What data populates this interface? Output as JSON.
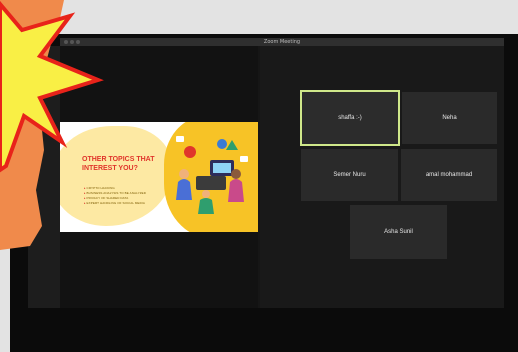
{
  "window": {
    "title": "Zoom Meeting"
  },
  "slide": {
    "title": "OTHER TOPICS THAT INTEREST YOU?",
    "bullets": [
      "CRYPTO HACKING",
      "BUSINESS ANALYSIS TO BE ANALYZED",
      "PRIVACY OF SHARED DATA",
      "EXPERT HANDLING OF SOCIAL MEDIA"
    ]
  },
  "participants": [
    {
      "name": "shaffa :-)",
      "active": true
    },
    {
      "name": "Neha",
      "active": false
    },
    {
      "name": "Semer Nuru",
      "active": false
    },
    {
      "name": "amal mohammad",
      "active": false
    },
    {
      "name": "Asha Sunil",
      "active": false
    }
  ],
  "colors": {
    "active_speaker_border": "#cfe88a",
    "tile_background": "#2a2a2a",
    "slide_title": "#e0352b",
    "slide_accent": "#f7c326",
    "callout_fill": "#f9ef45",
    "callout_outline": "#e8231a",
    "callout_backdrop": "#f08a4b"
  }
}
